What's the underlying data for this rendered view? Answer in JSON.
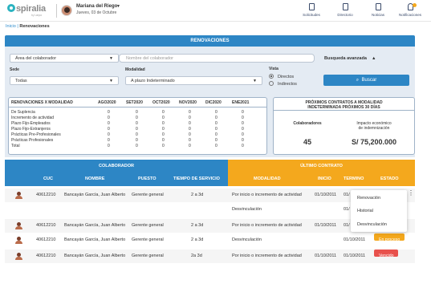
{
  "brand": {
    "logo_text": "spiralia",
    "logo_sub": "by Lanpa"
  },
  "user": {
    "name": "Mariana del Riego",
    "date": "Jueves, 03 de Octubre"
  },
  "topnav": [
    {
      "label": "Solicitudes",
      "icon": "clipboard-icon"
    },
    {
      "label": "Directorio",
      "icon": "address-book-icon"
    },
    {
      "label": "Noticias",
      "icon": "newspaper-icon"
    },
    {
      "label": "Notificaciones",
      "icon": "bell-icon"
    }
  ],
  "breadcrumb": {
    "home": "Inicio",
    "sep": "|",
    "current": "Renovaciones"
  },
  "page_title": "RENOVACIONES",
  "filters": {
    "area_select": "Área del colaborador",
    "name_placeholder": "Nombre del colaborador",
    "advanced": "Busqueda avanzada",
    "advanced_caret": "▲",
    "sede_label": "Sede",
    "sede_value": "Todas",
    "modalidad_label": "Modalidad",
    "modalidad_value": "A plazo Indeterminado",
    "vista_label": "Vista",
    "vista_options": [
      "Directos",
      "Indirectos"
    ],
    "search_button": "Buscar"
  },
  "modalidad_table": {
    "headers": [
      "RENOVACIONES X MODALIDAD",
      "AGO2020",
      "SET2020",
      "OCT2020",
      "NOV2020",
      "DIC2020",
      "ENE2021"
    ],
    "rows": [
      [
        "De Suplencia",
        "0",
        "0",
        "0",
        "0",
        "0",
        "0"
      ],
      [
        "Incremento de actividad",
        "0",
        "0",
        "0",
        "0",
        "0",
        "0"
      ],
      [
        "Plazo Fijo-Empleados",
        "0",
        "0",
        "0",
        "0",
        "0",
        "0"
      ],
      [
        "Plazo Fijo-Extranjeros",
        "0",
        "0",
        "0",
        "0",
        "0",
        "0"
      ],
      [
        "Prácticas Pre-Profesionales",
        "0",
        "0",
        "0",
        "0",
        "0",
        "0"
      ],
      [
        "Prácticas Profesionales",
        "0",
        "0",
        "0",
        "0",
        "0",
        "0"
      ],
      [
        "Total",
        "0",
        "0",
        "0",
        "0",
        "0",
        "0"
      ]
    ]
  },
  "kpi": {
    "title_line1": "PRÓXIMOS CONTRATOS A MODALIDAD",
    "title_line2": "INDETERMINADA PRÓXIMOS 30 DÍAS",
    "colab_label": "Colaboradores",
    "colab_value": "45",
    "impact_label_1": "Impacto económico",
    "impact_label_2": "de indemnización",
    "impact_value": "S/ 75,200.000"
  },
  "table": {
    "group1": "COLABORADOR",
    "group2": "ÚLTIMO CONTRATO",
    "headers": [
      "CUC",
      "NOMBRE",
      "PUESTO",
      "TIEMPO DE SERVICIO",
      "MODALIDAD",
      "INICIO",
      "TERMINO",
      "ESTADO"
    ],
    "rows": [
      {
        "cuc": "40612210",
        "nombre": "Bancayán García, Juan Alberto",
        "puesto": "Gerente general",
        "tiempo": "2 a 3d",
        "modalidad": "Por inicio o incremento de actividad",
        "inicio": "01/10/2011",
        "termino": "01/",
        "estado": "",
        "avatar": true
      },
      {
        "cuc": "",
        "nombre": "",
        "puesto": "",
        "tiempo": "",
        "modalidad": "Desvinculación",
        "inicio": "",
        "termino": "01/",
        "estado": "",
        "avatar": false
      },
      {
        "cuc": "40612210",
        "nombre": "Bancayán García, Juan Alberto",
        "puesto": "Gerente general",
        "tiempo": "2 a 3d",
        "modalidad": "Por inicio o incremento de actividad",
        "inicio": "01/10/2011",
        "termino": "01/",
        "estado": "",
        "avatar": true
      },
      {
        "cuc": "40612210",
        "nombre": "Bancayán García, Juan Alberto",
        "puesto": "Gerente general",
        "tiempo": "2 a 3d",
        "modalidad": "Desvinculación",
        "inicio": "",
        "termino": "01/10/2011",
        "estado": "En proceso",
        "avatar": true
      },
      {
        "cuc": "40612210",
        "nombre": "Bancayán García, Juan Alberto",
        "puesto": "Gerente general",
        "tiempo": "2a 3d",
        "modalidad": "Por inicio o incremento de actividad",
        "inicio": "01/10/2011",
        "termino": "01/10/2011",
        "estado": "Vencido",
        "avatar": true
      }
    ]
  },
  "context_menu": [
    "Renovación",
    "Historial",
    "Desvinculación"
  ],
  "colors": {
    "primary": "#2d86c5",
    "orange": "#f4a81d",
    "teal": "#2bb3c0",
    "red": "#e8514c"
  }
}
